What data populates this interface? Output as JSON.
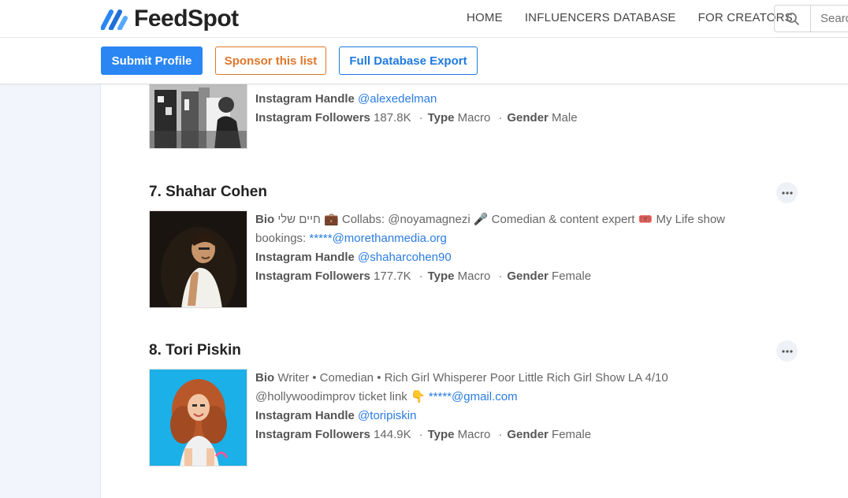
{
  "header": {
    "logo_text": "FeedSpot",
    "nav": [
      "HOME",
      "INFLUENCERS DATABASE",
      "FOR CREATORS"
    ],
    "search_placeholder": "Search"
  },
  "actions": {
    "submit_label": "Submit Profile",
    "sponsor_label": "Sponsor this list",
    "export_label": "Full Database Export"
  },
  "labels": {
    "bio": "Bio",
    "handle": "Instagram Handle",
    "followers": "Instagram Followers",
    "type": "Type",
    "gender": "Gender",
    "dot": "·"
  },
  "entries": [
    {
      "handle": "@alexedelman",
      "followers": "187.8K",
      "type": "Macro",
      "gender": "Male"
    },
    {
      "title": "7. Shahar Cohen",
      "bio_text_1": "חיים שלי 💼 Collabs: @noyamagnezi 🎤 Comedian & content expert 🎟️ My Life show bookings: ",
      "bio_link": "*****@morethanmedia.org",
      "handle": "@shaharcohen90",
      "followers": "177.7K",
      "type": "Macro",
      "gender": "Female"
    },
    {
      "title": "8. Tori Piskin",
      "bio_text_1": "Writer • Comedian • Rich Girl Whisperer Poor Little Rich Girl Show LA 4/10 @hollywoodimprov ticket link 👇 ",
      "bio_link": "*****@gmail.com",
      "handle": "@toripiskin",
      "followers": "144.9K",
      "type": "Macro",
      "gender": "Female"
    }
  ],
  "colors": {
    "primary": "#2a86f3",
    "sponsor": "#e07628",
    "link": "#2b7ce0",
    "sidebar_bg": "#f2f6fc"
  }
}
